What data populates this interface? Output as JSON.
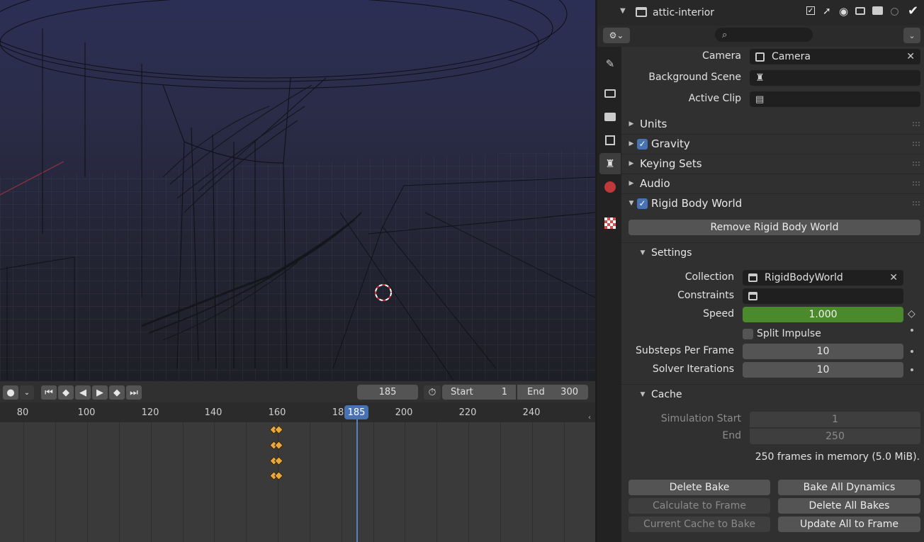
{
  "outliner": {
    "collection_name": "attic-interior"
  },
  "scene": {
    "camera_label": "Camera",
    "camera_value": "Camera",
    "background_scene_label": "Background Scene",
    "active_clip_label": "Active Clip"
  },
  "panels": {
    "units": "Units",
    "gravity": "Gravity",
    "keying_sets": "Keying Sets",
    "audio": "Audio",
    "rigid_body_world": "Rigid Body World"
  },
  "rigid_body": {
    "remove_button": "Remove Rigid Body World",
    "settings_title": "Settings",
    "collection_label": "Collection",
    "collection_value": "RigidBodyWorld",
    "constraints_label": "Constraints",
    "speed_label": "Speed",
    "speed_value": "1.000",
    "split_impulse_label": "Split Impulse",
    "substeps_label": "Substeps Per Frame",
    "substeps_value": "10",
    "solver_label": "Solver Iterations",
    "solver_value": "10"
  },
  "cache": {
    "title": "Cache",
    "sim_start_label": "Simulation Start",
    "sim_start_value": "1",
    "end_label": "End",
    "end_value": "250",
    "memory_info": "250 frames in memory (5.0 MiB).",
    "buttons": {
      "delete_bake": "Delete Bake",
      "bake_all": "Bake All Dynamics",
      "calculate_to_frame": "Calculate to Frame",
      "delete_all_bakes": "Delete All Bakes",
      "current_cache_to_bake": "Current Cache to Bake",
      "update_all_to_frame": "Update All to Frame"
    }
  },
  "timeline": {
    "current_frame": "185",
    "start_label": "Start",
    "start_value": "1",
    "end_label": "End",
    "end_value": "300",
    "playhead_label": "185",
    "ruler_labels": [
      "80",
      "100",
      "120",
      "140",
      "160",
      "18",
      "200",
      "220",
      "240"
    ]
  },
  "colors": {
    "accent": "#4772b3",
    "speed_bar": "#4a8a2c",
    "keyframe": "#e8a73c"
  }
}
